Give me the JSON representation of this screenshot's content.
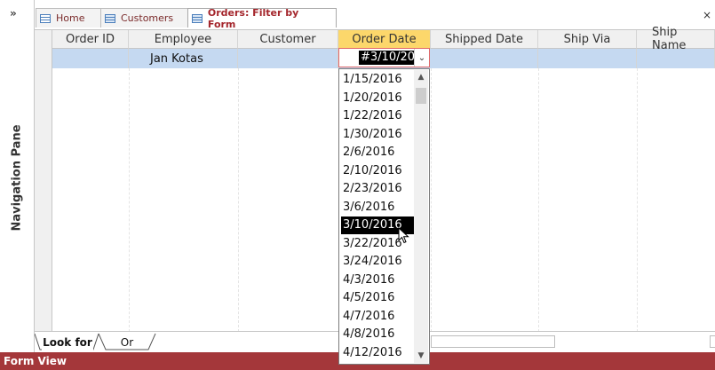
{
  "nav_pane": {
    "chevron": "»",
    "label": "Navigation Pane"
  },
  "tabs": [
    {
      "label": "Home",
      "icon": "form-icon"
    },
    {
      "label": "Customers",
      "icon": "table-icon"
    },
    {
      "label": "Orders: Filter by Form",
      "icon": "table-icon",
      "active": true
    }
  ],
  "close_glyph": "×",
  "columns": [
    "Order ID",
    "Employee",
    "Customer",
    "Order Date",
    "Shipped Date",
    "Ship Via",
    "Ship Name"
  ],
  "selected_column": "Order Date",
  "filter_row": {
    "employee": "Jan Kotas",
    "order_date": "#3/10/20"
  },
  "dropdown": {
    "options": [
      "1/15/2016",
      "1/20/2016",
      "1/22/2016",
      "1/30/2016",
      "2/6/2016",
      "2/10/2016",
      "2/23/2016",
      "3/6/2016",
      "3/10/2016",
      "3/22/2016",
      "3/24/2016",
      "4/3/2016",
      "4/5/2016",
      "4/7/2016",
      "4/8/2016",
      "4/12/2016"
    ],
    "highlighted": "3/10/2016"
  },
  "bottom_tabs": {
    "look_for": "Look for",
    "or": "Or"
  },
  "status": "Form View",
  "colors": {
    "accent": "#a4373a",
    "selected_header": "#fcd76b",
    "selected_row": "#c5d9f1"
  }
}
